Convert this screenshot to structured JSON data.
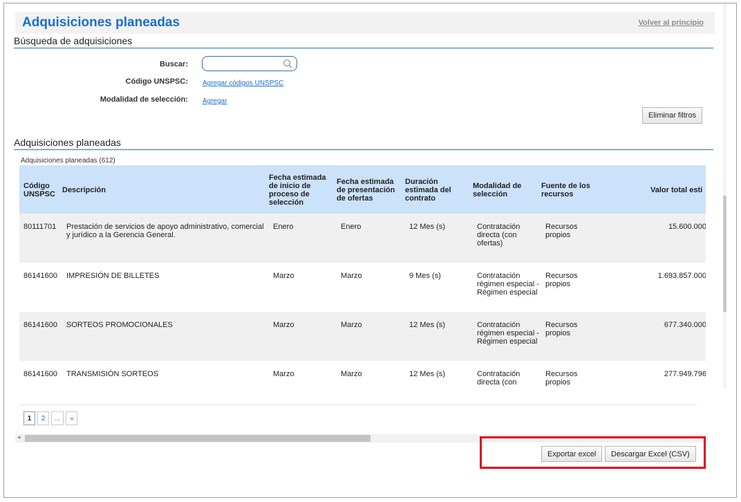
{
  "header": {
    "title": "Adquisiciones planeadas",
    "back_link": "Volver al principio"
  },
  "search_section": {
    "heading": "Búsqueda de adquisiciones",
    "search_label": "Buscar:",
    "search_value": "",
    "unspsc_label": "Código UNSPSC:",
    "unspsc_link": "Agregar códigos UNSPSC",
    "modalidad_label": "Modalidad de selección:",
    "modalidad_link": "Agregar",
    "clear_filters": "Eliminar filtros"
  },
  "results_section": {
    "heading": "Adquisiciones planeadas",
    "count_label": "Adquisiciones planeadas (612)"
  },
  "table": {
    "columns": [
      "Código UNSPSC",
      "Descripción",
      "Fecha estimada de inicio de proceso de selección",
      "Fecha estimada de presentación de ofertas",
      "Duración estimada del contrato",
      "Modalidad de selección",
      "Fuente de los recursos",
      "Valor total esti"
    ],
    "rows": [
      {
        "code": "80111701",
        "description": "Prestación de servicios de apoyo administrativo, comercial y jurídico a la Gerencia General.",
        "start": "Enero",
        "offers": "Enero",
        "duration": "12 Mes (s)",
        "modality": "Contratación directa (con ofertas)",
        "source": "Recursos propios",
        "value": "15.600.000"
      },
      {
        "code": "86141600",
        "description": "IMPRESIÓN DE BILLETES",
        "start": "Marzo",
        "offers": "Marzo",
        "duration": "9 Mes (s)",
        "modality": "Contratación régimen especial - Régimen especial",
        "source": "Recursos propios",
        "value": "1.693.857.000"
      },
      {
        "code": "86141600",
        "description": "SORTEOS PROMOCIONALES",
        "start": "Marzo",
        "offers": "Marzo",
        "duration": "12 Mes (s)",
        "modality": "Contratación régimen especial - Régimen especial",
        "source": "Recursos propios",
        "value": "677.340.000"
      },
      {
        "code": "86141600",
        "description": "TRANSMISIÓN SORTEOS",
        "start": "Marzo",
        "offers": "Marzo",
        "duration": "12 Mes (s)",
        "modality": "Contratación directa (con ofertas)",
        "source": "Recursos propios",
        "value": "277.949.796"
      }
    ]
  },
  "pagination": {
    "pages": [
      "1",
      "2",
      "...",
      "»"
    ],
    "current": "1"
  },
  "actions": {
    "export_excel": "Exportar excel",
    "download_csv": "Descargar Excel (CSV)"
  },
  "icons": {
    "search": "search-icon",
    "scroll_left": "◂"
  },
  "colors": {
    "accent": "#1a6fc9",
    "header_bg": "#cce1fa",
    "highlight": "#e2001a"
  }
}
